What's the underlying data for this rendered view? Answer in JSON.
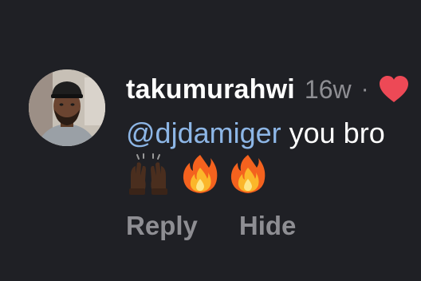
{
  "comment": {
    "username": "takumurahwi",
    "age": "16w",
    "separator": "·",
    "mention": "@djdamiger",
    "text": "you bro",
    "emojis": [
      "raised-hands-icon",
      "fire-icon",
      "fire-icon"
    ],
    "actions": {
      "reply_label": "Reply",
      "hide_label": "Hide"
    }
  },
  "colors": {
    "background": "#1f2025",
    "mention": "#8db6e6",
    "secondary_text": "#8e8e93",
    "heart": "#ed4956"
  }
}
